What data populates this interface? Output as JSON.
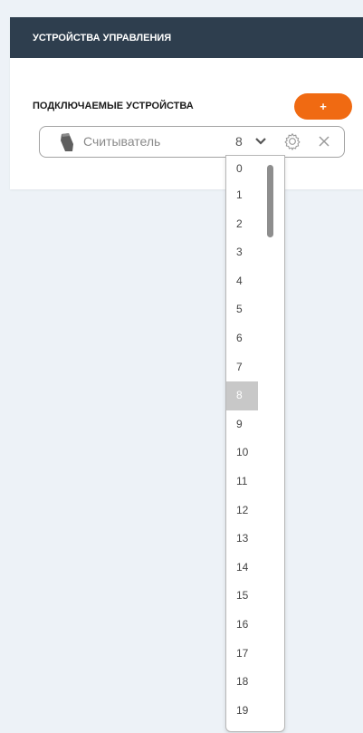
{
  "panel": {
    "title": "УСТРОЙСТВА УПРАВЛЕНИЯ",
    "section_label": "ПОДКЛЮЧАЕМЫЕ УСТРОЙСТВА",
    "add_button_label": "+"
  },
  "device": {
    "icon": "card-reader-icon",
    "name": "Считыватель",
    "selected_value": "8"
  },
  "dropdown": {
    "options": [
      "0",
      "1",
      "2",
      "3",
      "4",
      "5",
      "6",
      "7",
      "8",
      "9",
      "10",
      "11",
      "12",
      "13",
      "14",
      "15",
      "16",
      "17",
      "18",
      "19"
    ],
    "selected_index": 8
  },
  "colors": {
    "header_bg": "#2e3e4e",
    "accent": "#f06a12",
    "page_bg": "#edf2f7"
  }
}
